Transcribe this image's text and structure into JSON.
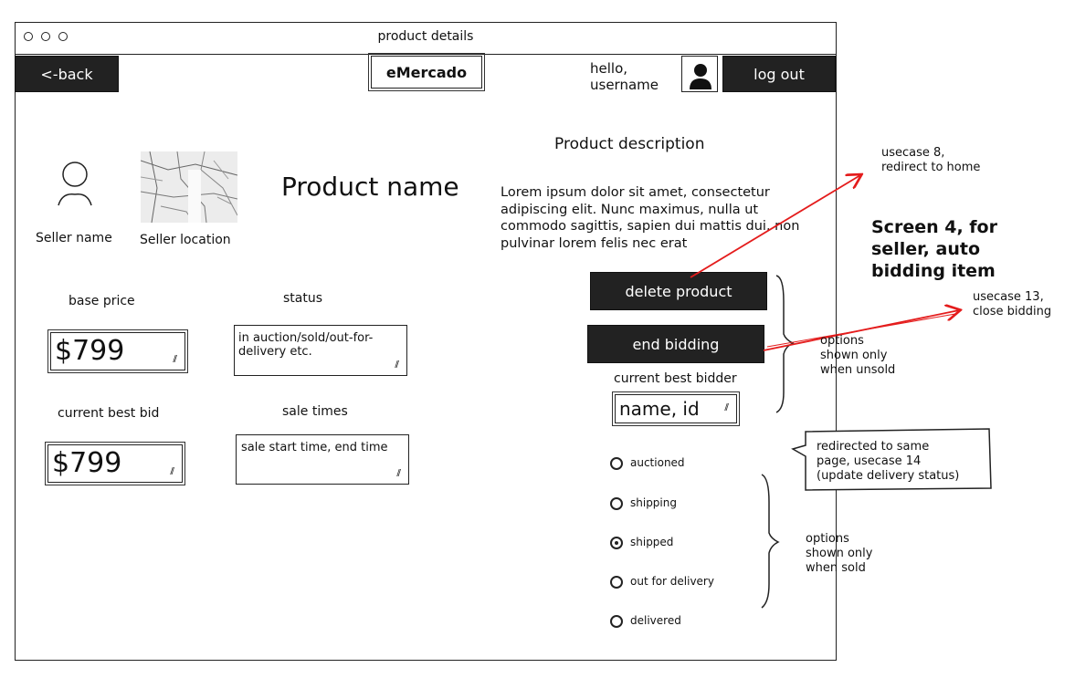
{
  "window": {
    "title": "product details"
  },
  "header": {
    "back_label": "<-back",
    "brand": "eMercado",
    "greeting_line1": "hello,",
    "greeting_line2": "username",
    "logout_label": "log out"
  },
  "seller": {
    "name_label": "Seller name",
    "location_label": "Seller location"
  },
  "product": {
    "name": "Product name",
    "description_title": "Product description",
    "description_lines": [
      "Lorem ipsum dolor sit amet, consectetur",
      "adipiscing elit. Nunc maximus, nulla ut",
      "commodo sagittis, sapien dui mattis dui, non",
      "pulvinar lorem felis nec erat"
    ]
  },
  "fields": {
    "base_price_label": "base price",
    "base_price_value": "$799",
    "status_label": "status",
    "status_placeholder_line1": "in auction/sold/out-for-",
    "status_placeholder_line2": "delivery etc.",
    "best_bid_label": "current best bid",
    "best_bid_value": "$799",
    "sale_times_label": "sale times",
    "sale_times_placeholder": "sale start time, end time"
  },
  "actions": {
    "delete_label": "delete product",
    "end_bidding_label": "end bidding",
    "best_bidder_label": "current best bidder",
    "best_bidder_value": "name, id"
  },
  "delivery_status": {
    "options": [
      "auctioned",
      "shipping",
      "shipped",
      "out for delivery",
      "delivered"
    ],
    "selected": "shipped"
  },
  "annotations": {
    "usecase8_line1": "usecase 8,",
    "usecase8_line2": "redirect to home",
    "screen_title_line1": "Screen 4, for",
    "screen_title_line2": "seller, auto",
    "screen_title_line3": "bidding item",
    "usecase13_line1": "usecase 13,",
    "usecase13_line2": "close bidding",
    "unsold_line1": "options",
    "unsold_line2": "shown only",
    "unsold_line3": "when unsold",
    "redirect_line1": "redirected to same",
    "redirect_line2": "page, usecase 14",
    "redirect_line3": "(update delivery status)",
    "sold_line1": "options",
    "sold_line2": "shown only",
    "sold_line3": "when sold"
  },
  "colors": {
    "arrow": "#e41c1c",
    "dark": "#222222"
  }
}
